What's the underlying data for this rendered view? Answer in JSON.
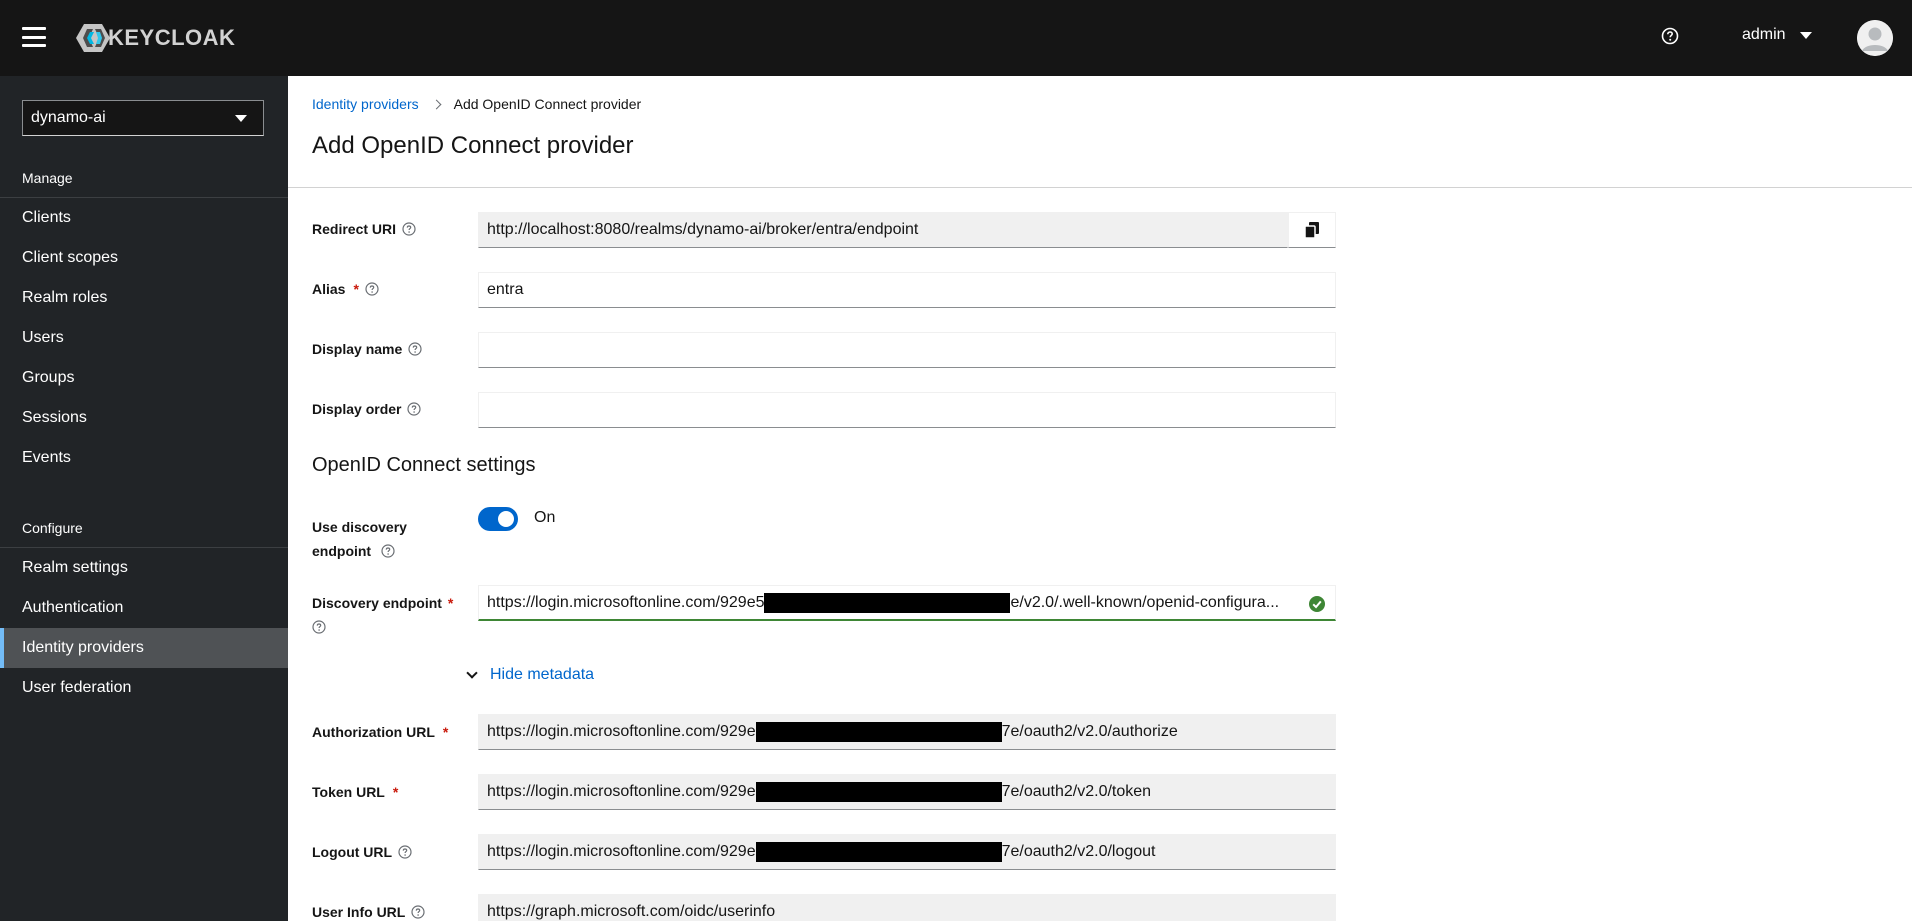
{
  "header": {
    "logo_text": "KEYCLOAK",
    "user_name": "admin"
  },
  "sidebar": {
    "realm": "dynamo-ai",
    "manage_title": "Manage",
    "manage_items": [
      {
        "label": "Clients"
      },
      {
        "label": "Client scopes"
      },
      {
        "label": "Realm roles"
      },
      {
        "label": "Users"
      },
      {
        "label": "Groups"
      },
      {
        "label": "Sessions"
      },
      {
        "label": "Events"
      }
    ],
    "configure_title": "Configure",
    "configure_items": [
      {
        "label": "Realm settings"
      },
      {
        "label": "Authentication"
      },
      {
        "label": "Identity providers",
        "active": true
      },
      {
        "label": "User federation"
      }
    ]
  },
  "breadcrumb": {
    "parent": "Identity providers",
    "current": "Add OpenID Connect provider"
  },
  "page": {
    "title": "Add OpenID Connect provider",
    "section_title": "OpenID Connect settings"
  },
  "form": {
    "redirect_uri": {
      "label": "Redirect URI",
      "value": "http://localhost:8080/realms/dynamo-ai/broker/entra/endpoint"
    },
    "alias": {
      "label": "Alias",
      "value": "entra"
    },
    "display_name": {
      "label": "Display name",
      "value": ""
    },
    "display_order": {
      "label": "Display order",
      "value": ""
    },
    "use_discovery": {
      "label_line1": "Use discovery",
      "label_line2": "endpoint",
      "state": "On"
    },
    "discovery_endpoint": {
      "label": "Discovery endpoint",
      "value_prefix": "https://login.microsoftonline.com/929e5",
      "value_suffix": "e/v2.0/.well-known/openid-configura..."
    },
    "metadata_toggle": "Hide metadata",
    "authorization_url": {
      "label": "Authorization URL",
      "value_prefix": "https://login.microsoftonline.com/929e",
      "value_suffix": "7e/oauth2/v2.0/authorize"
    },
    "token_url": {
      "label": "Token URL",
      "value_prefix": "https://login.microsoftonline.com/929e",
      "value_suffix": "7e/oauth2/v2.0/token"
    },
    "logout_url": {
      "label": "Logout URL",
      "value_prefix": "https://login.microsoftonline.com/929e",
      "value_suffix": "7e/oauth2/v2.0/logout"
    },
    "user_info_url": {
      "label": "User Info URL",
      "value": "https://graph.microsoft.com/oidc/userinfo"
    }
  },
  "colors": {
    "masthead": "#151515",
    "sidebar": "#212427",
    "link": "#0066cc",
    "required": "#c9190b",
    "valid": "#3e8635"
  }
}
